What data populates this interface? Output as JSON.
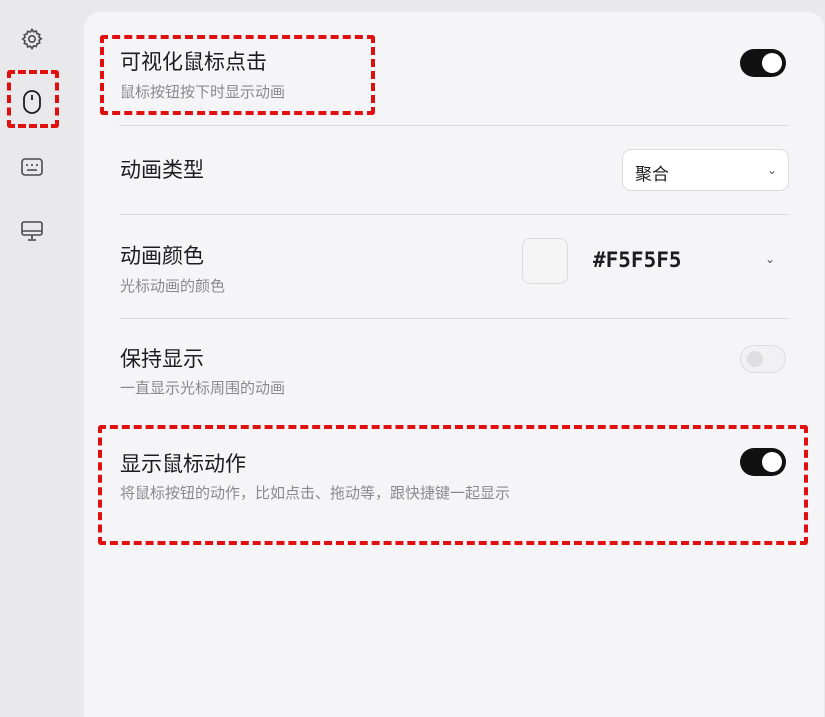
{
  "sidebar": {
    "items": [
      {
        "icon": "gear-icon"
      },
      {
        "icon": "mouse-icon",
        "active": true
      },
      {
        "icon": "keyboard-icon"
      },
      {
        "icon": "display-icon"
      }
    ]
  },
  "settings": {
    "visualize_click": {
      "title": "可视化鼠标点击",
      "subtitle": "鼠标按钮按下时显示动画",
      "enabled": true
    },
    "animation_type": {
      "title": "动画类型",
      "selected": "聚合"
    },
    "animation_color": {
      "title": "动画颜色",
      "subtitle": "光标动画的颜色",
      "value": "#F5F5F5",
      "swatch_color": "#F5F5F5"
    },
    "keep_visible": {
      "title": "保持显示",
      "subtitle": "一直显示光标周围的动画",
      "enabled": false
    },
    "show_mouse_actions": {
      "title": "显示鼠标动作",
      "subtitle": "将鼠标按钮的动作，比如点击、拖动等，跟快捷键一起显示",
      "enabled": true
    }
  },
  "colors": {
    "highlight": "#e01010",
    "toggle_on": "#111111"
  }
}
